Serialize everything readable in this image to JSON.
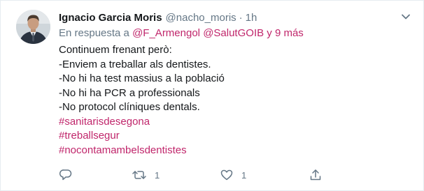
{
  "tweet": {
    "author_name": "Ignacio Garcia Moris",
    "handle": "@nacho_moris",
    "separator": "·",
    "time": "1h",
    "reply_prefix": "En respuesta a",
    "reply_mention_1": "@F_Armengol",
    "reply_mention_2": "@SalutGOIB",
    "reply_suffix": "y 9 más",
    "lines": [
      "Continuem frenant però:",
      "-Enviem a treballar als dentistes.",
      "-No hi ha test massius a la població",
      "-No hi ha PCR a professionals",
      "-No protocol clíniques dentals."
    ],
    "hashtags": [
      "#sanitarisdesegona",
      "#treballsegur",
      "#nocontamambelsdentistes"
    ]
  },
  "actions": {
    "reply_count": "",
    "retweet_count": "1",
    "like_count": "1"
  },
  "icons": {
    "menu": "chevron-down-icon",
    "reply": "reply-icon",
    "retweet": "retweet-icon",
    "like": "heart-icon",
    "share": "share-icon"
  },
  "colors": {
    "accent": "#c0266b",
    "secondary_text": "#657786",
    "primary_text": "#14171a",
    "border": "#e6ecf0"
  }
}
